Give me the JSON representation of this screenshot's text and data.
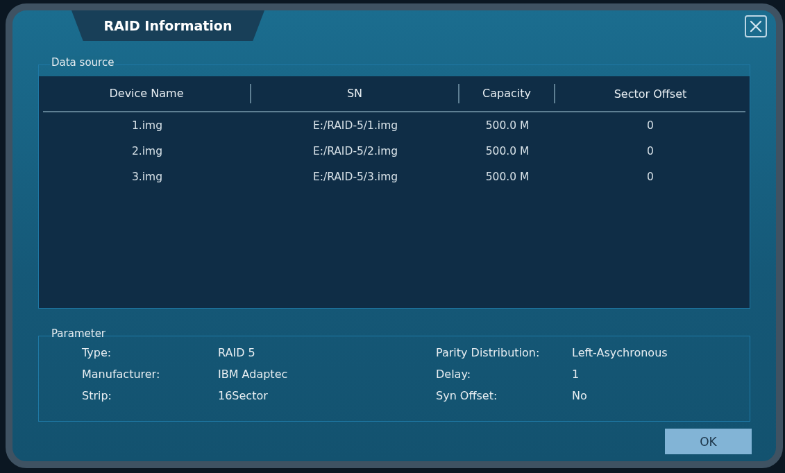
{
  "dialog": {
    "title": "RAID Information"
  },
  "data_source": {
    "label": "Data source",
    "columns": [
      "Device Name",
      "SN",
      "Capacity",
      "Sector Offset"
    ],
    "rows": [
      {
        "cells": [
          "1.img",
          "E:/RAID-5/1.img",
          "500.0 M",
          "0"
        ]
      },
      {
        "cells": [
          "2.img",
          "E:/RAID-5/2.img",
          "500.0 M",
          "0"
        ]
      },
      {
        "cells": [
          "3.img",
          "E:/RAID-5/3.img",
          "500.0 M",
          "0"
        ]
      }
    ]
  },
  "parameter": {
    "label": "Parameter",
    "fields": [
      {
        "label": "Type:",
        "value": "RAID 5"
      },
      {
        "label": "Parity Distribution:",
        "value": "Left-Asychronous"
      },
      {
        "label": "Manufacturer:",
        "value": "IBM Adaptec"
      },
      {
        "label": "Delay:",
        "value": "1"
      },
      {
        "label": "Strip:",
        "value": "16Sector"
      },
      {
        "label": "Syn Offset:",
        "value": "No"
      }
    ]
  },
  "buttons": [
    "OK"
  ]
}
